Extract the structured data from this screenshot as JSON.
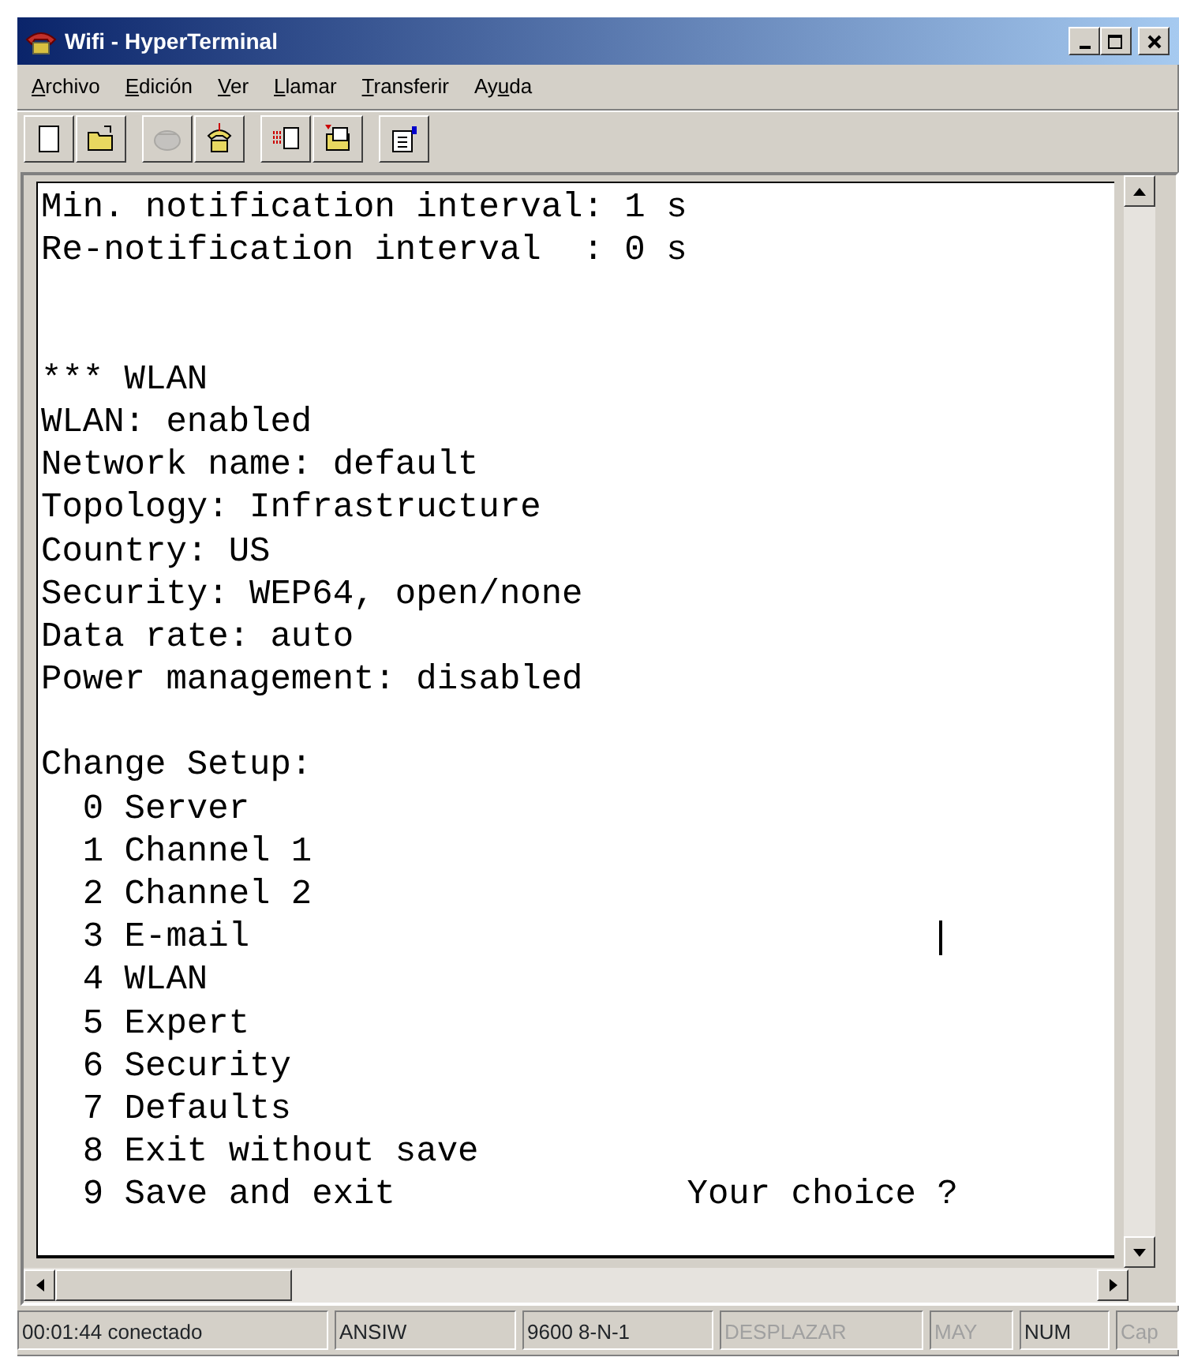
{
  "window": {
    "title": "Wifi - HyperTerminal"
  },
  "menu": [
    {
      "key": "A",
      "after": "rchivo"
    },
    {
      "key": "E",
      "after": "dición"
    },
    {
      "key": "V",
      "after": "er"
    },
    {
      "key": "L",
      "after": "lamar"
    },
    {
      "key": "T",
      "after": "ransferir"
    },
    {
      "before": "Ay",
      "key": "u",
      "after": "da"
    }
  ],
  "toolbar": [
    [
      {
        "kind": "new",
        "disabled": false
      },
      {
        "kind": "open",
        "disabled": false
      }
    ],
    [
      {
        "kind": "disconnect",
        "disabled": true
      },
      {
        "kind": "call",
        "disabled": false
      }
    ],
    [
      {
        "kind": "send",
        "disabled": false
      },
      {
        "kind": "receive",
        "disabled": false
      }
    ],
    [
      {
        "kind": "properties",
        "disabled": false
      }
    ]
  ],
  "terminal": {
    "lines": [
      {
        "kind": "text",
        "text": "Min. notification interval: 1 s"
      },
      {
        "kind": "text",
        "text": "Re-notification interval  : 0 s"
      },
      {
        "kind": "blank"
      },
      {
        "kind": "blank"
      },
      {
        "kind": "text",
        "text": "*** WLAN"
      },
      {
        "kind": "text",
        "text": "WLAN: enabled"
      },
      {
        "kind": "text",
        "text": "Network name: default"
      },
      {
        "kind": "text",
        "text": "Topology: Infrastructure"
      },
      {
        "kind": "text",
        "text": "Country: US"
      },
      {
        "kind": "text",
        "text": "Security: WEP64, open/none"
      },
      {
        "kind": "text",
        "text": "Data rate: auto"
      },
      {
        "kind": "text",
        "text": "Power management: disabled"
      },
      {
        "kind": "blank"
      },
      {
        "kind": "text",
        "text": "Change Setup:"
      },
      {
        "kind": "text",
        "text": "  0 Server"
      },
      {
        "kind": "text",
        "text": "  1 Channel 1"
      },
      {
        "kind": "text",
        "text": "  2 Channel 2"
      },
      {
        "kind": "text",
        "text": "  3 E-mail"
      },
      {
        "kind": "text",
        "text": "  4 WLAN"
      },
      {
        "kind": "text",
        "text": "  5 Expert"
      },
      {
        "kind": "text",
        "text": "  6 Security"
      },
      {
        "kind": "text",
        "text": "  7 Defaults"
      },
      {
        "kind": "text",
        "text": "  8 Exit without save"
      },
      {
        "kind": "text",
        "text": "  9 Save and exit              Your choice ?"
      }
    ]
  },
  "status_bar": [
    {
      "text": "00:01:44 conectado",
      "enabled": true
    },
    {
      "text": "ANSIW",
      "enabled": true
    },
    {
      "text": "9600 8-N-1",
      "enabled": true
    },
    {
      "text": "DESPLAZAR",
      "enabled": false
    },
    {
      "text": "MAY",
      "enabled": false
    },
    {
      "text": "NUM",
      "enabled": true
    },
    {
      "text": "Cap",
      "enabled": false
    }
  ]
}
